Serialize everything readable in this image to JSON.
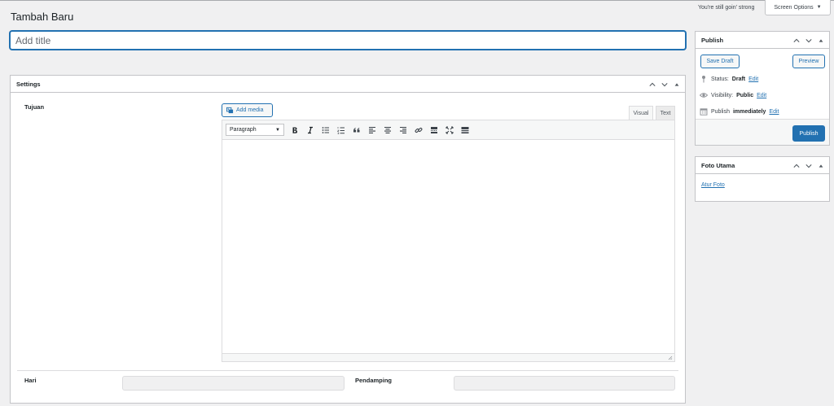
{
  "page": {
    "title": "Tambah Baru"
  },
  "header": {
    "greeting": "You're still goin' strong",
    "screen_options_label": "Screen Options"
  },
  "title_field": {
    "placeholder": "Add title",
    "value": ""
  },
  "settings_box": {
    "heading": "Settings",
    "tujuan_label": "Tujuan",
    "hari_label": "Hari",
    "pendamping_label": "Pendamping",
    "hari_value": "",
    "pendamping_value": ""
  },
  "editor": {
    "add_media_label": "Add media",
    "tab_visual": "Visual",
    "tab_text": "Text",
    "format_selected": "Paragraph",
    "toolbar_icons": [
      "bold-icon",
      "italic-icon",
      "bullet-list-icon",
      "numbered-list-icon",
      "blockquote-icon",
      "align-left-icon",
      "align-center-icon",
      "align-right-icon",
      "link-icon",
      "read-more-icon",
      "fullscreen-icon",
      "toolbar-toggle-icon"
    ]
  },
  "publish_box": {
    "heading": "Publish",
    "save_draft_label": "Save Draft",
    "preview_label": "Preview",
    "status_label": "Status:",
    "status_value": "Draft",
    "visibility_label": "Visibility:",
    "visibility_value": "Public",
    "publish_label": "Publish",
    "publish_value": "immediately",
    "edit_link": "Edit",
    "publish_button_label": "Publish"
  },
  "featured_box": {
    "heading": "Foto Utama",
    "set_image_link": "Atur Foto"
  },
  "colors": {
    "accent": "#2271b1",
    "background": "#f0f0f1",
    "border": "#c3c4c7"
  }
}
